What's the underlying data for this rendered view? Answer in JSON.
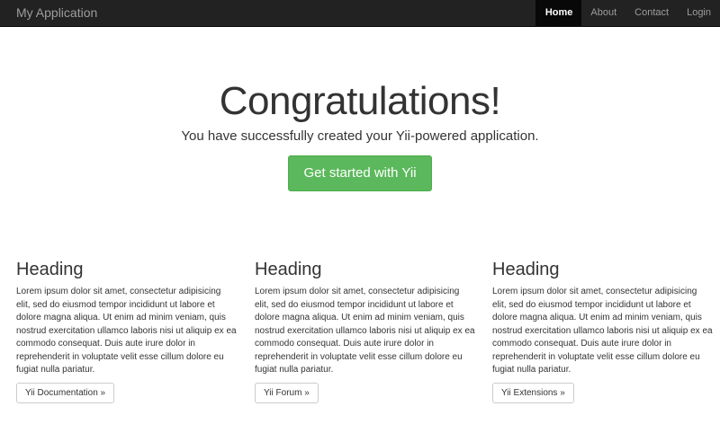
{
  "navbar": {
    "brand": "My Application",
    "items": [
      {
        "label": "Home",
        "active": true
      },
      {
        "label": "About",
        "active": false
      },
      {
        "label": "Contact",
        "active": false
      },
      {
        "label": "Login",
        "active": false
      }
    ]
  },
  "jumbotron": {
    "title": "Congratulations!",
    "lead": "You have successfully created your Yii-powered application.",
    "button_label": "Get started with Yii"
  },
  "columns": [
    {
      "heading": "Heading",
      "text": "Lorem ipsum dolor sit amet, consectetur adipisicing elit, sed do eiusmod tempor incididunt ut labore et dolore magna aliqua. Ut enim ad minim veniam, quis nostrud exercitation ullamco laboris nisi ut aliquip ex ea commodo consequat. Duis aute irure dolor in reprehenderit in voluptate velit esse cillum dolore eu fugiat nulla pariatur.",
      "button_label": "Yii Documentation »"
    },
    {
      "heading": "Heading",
      "text": "Lorem ipsum dolor sit amet, consectetur adipisicing elit, sed do eiusmod tempor incididunt ut labore et dolore magna aliqua. Ut enim ad minim veniam, quis nostrud exercitation ullamco laboris nisi ut aliquip ex ea commodo consequat. Duis aute irure dolor in reprehenderit in voluptate velit esse cillum dolore eu fugiat nulla pariatur.",
      "button_label": "Yii Forum »"
    },
    {
      "heading": "Heading",
      "text": "Lorem ipsum dolor sit amet, consectetur adipisicing elit, sed do eiusmod tempor incididunt ut labore et dolore magna aliqua. Ut enim ad minim veniam, quis nostrud exercitation ullamco laboris nisi ut aliquip ex ea commodo consequat. Duis aute irure dolor in reprehenderit in voluptate velit esse cillum dolore eu fugiat nulla pariatur.",
      "button_label": "Yii Extensions »"
    }
  ],
  "colors": {
    "navbar_bg": "#222222",
    "navbar_active_bg": "#080808",
    "success": "#5cb85c"
  }
}
